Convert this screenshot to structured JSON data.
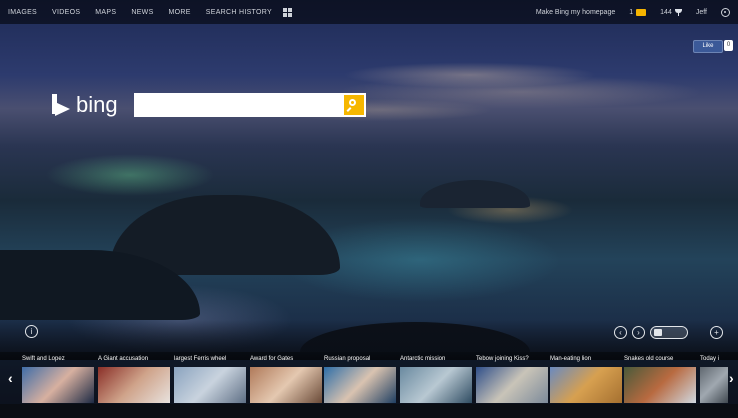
{
  "nav": {
    "items": [
      "IMAGES",
      "VIDEOS",
      "MAPS",
      "NEWS",
      "MORE",
      "SEARCH HISTORY"
    ],
    "right": {
      "homepage_link": "Make Bing my homepage",
      "rewards_count": "1",
      "points_label": "144",
      "user_name": "Jeff"
    }
  },
  "facebook": {
    "like_label": "Like",
    "count": "0"
  },
  "logo": {
    "text": "bing"
  },
  "search": {
    "value": "",
    "placeholder": ""
  },
  "colors": {
    "accent": "#f6b700",
    "topbar": "#000000"
  },
  "hotspots": {
    "info_label": "i",
    "prev_label": "‹",
    "next_label": "›",
    "plus_label": "+"
  },
  "news": {
    "tiles": [
      {
        "caption": "Swift and Lopez",
        "colors": [
          "#3f6da8",
          "#d7b0a0",
          "#1d2a44"
        ]
      },
      {
        "caption": "A Giant accusation",
        "colors": [
          "#8a2f28",
          "#cfa38a",
          "#e8e2de"
        ]
      },
      {
        "caption": "largest Ferris wheel",
        "colors": [
          "#8aa3bf",
          "#c9d3de",
          "#5e6f85"
        ]
      },
      {
        "caption": "Award for Gates",
        "colors": [
          "#b07a5a",
          "#e4c8b0",
          "#6a4a38"
        ]
      },
      {
        "caption": "Russian proposal",
        "colors": [
          "#2e6ea8",
          "#d9c3b0",
          "#1f3f62"
        ]
      },
      {
        "caption": "Antarctic mission",
        "colors": [
          "#6a8aa0",
          "#b8c8d2",
          "#2f4c62"
        ]
      },
      {
        "caption": "Tebow joining Kiss?",
        "colors": [
          "#2f4f8a",
          "#c9c4b8",
          "#7c8a9a"
        ]
      },
      {
        "caption": "Man-eating lion",
        "colors": [
          "#6a8ac0",
          "#d7a050",
          "#a57030"
        ]
      },
      {
        "caption": "Snakes old course",
        "colors": [
          "#4a5a3a",
          "#b86a40",
          "#d0d8e0"
        ]
      },
      {
        "caption": "Today i",
        "colors": [
          "#606870",
          "#a0a8b0",
          "#404850"
        ]
      }
    ]
  }
}
